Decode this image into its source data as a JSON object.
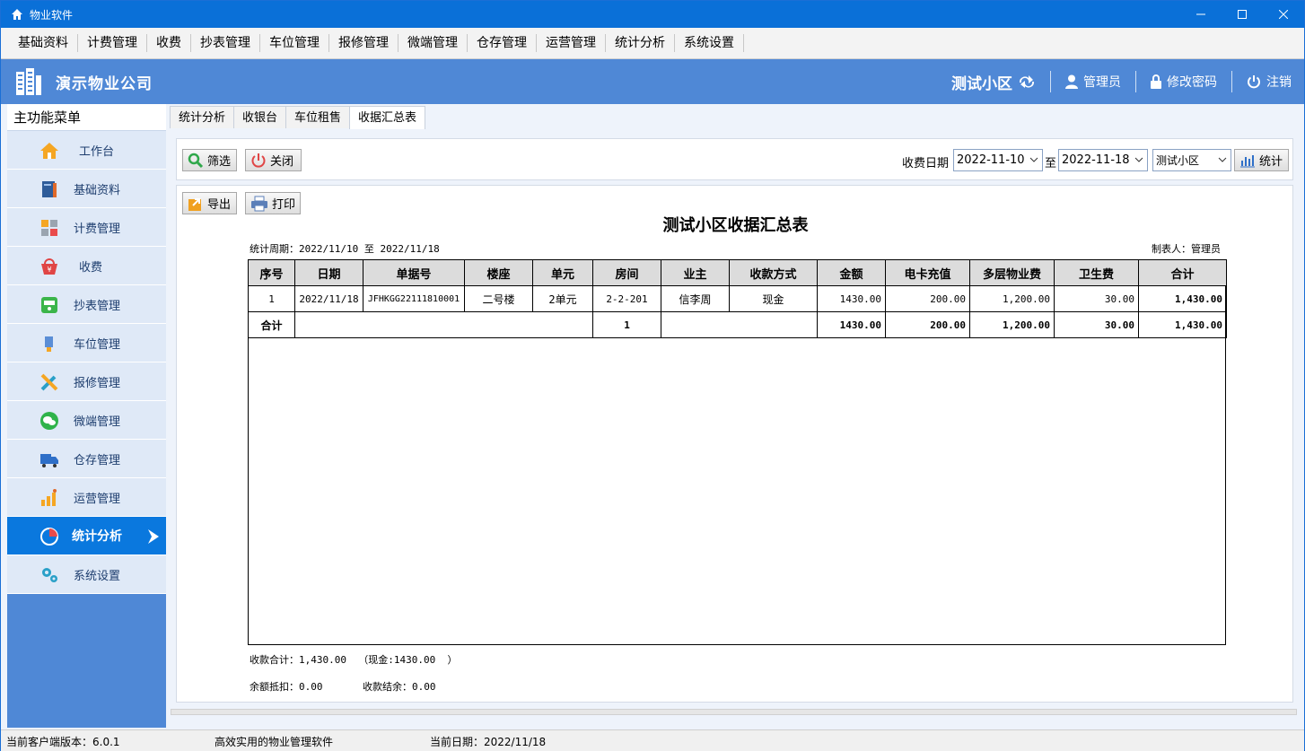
{
  "window": {
    "title": "物业软件"
  },
  "menu": [
    "基础资料",
    "计费管理",
    "收费",
    "抄表管理",
    "车位管理",
    "报修管理",
    "微端管理",
    "仓存管理",
    "运营管理",
    "统计分析",
    "系统设置"
  ],
  "header": {
    "company": "演示物业公司",
    "community": "测试小区",
    "user": "管理员",
    "change_password": "修改密码",
    "logout": "注销"
  },
  "sidebar": {
    "title": "主功能菜单",
    "items": [
      {
        "label": "工作台",
        "icon": "home-icon"
      },
      {
        "label": "基础资料",
        "icon": "book-icon"
      },
      {
        "label": "计费管理",
        "icon": "calculator-icon"
      },
      {
        "label": "收费",
        "icon": "basket-icon"
      },
      {
        "label": "抄表管理",
        "icon": "meter-icon"
      },
      {
        "label": "车位管理",
        "icon": "parking-icon"
      },
      {
        "label": "报修管理",
        "icon": "tools-icon"
      },
      {
        "label": "微端管理",
        "icon": "wechat-icon"
      },
      {
        "label": "仓存管理",
        "icon": "truck-icon"
      },
      {
        "label": "运营管理",
        "icon": "growth-icon"
      },
      {
        "label": "统计分析",
        "icon": "pie-chart-icon"
      },
      {
        "label": "系统设置",
        "icon": "gears-icon"
      }
    ]
  },
  "tabs": [
    "统计分析",
    "收银台",
    "车位租售",
    "收据汇总表"
  ],
  "toolbar": {
    "filter": "筛选",
    "close": "关闭",
    "date_label": "收费日期",
    "date_from": "2022-11-10",
    "to": "至",
    "date_to": "2022-11-18",
    "community": "测试小区",
    "stats": "统计"
  },
  "report": {
    "export": "导出",
    "print": "打印",
    "title": "测试小区收据汇总表",
    "period": "统计周期：2022/11/10 至 2022/11/18",
    "maker": "制表人：管理员",
    "columns": [
      "序号",
      "日期",
      "单据号",
      "楼座",
      "单元",
      "房间",
      "业主",
      "收款方式",
      "金额",
      "电卡充值",
      "多层物业费",
      "卫生费",
      "合计"
    ],
    "row": {
      "seq": "1",
      "date": "2022/11/18",
      "doc": "JFHKGG22111810001",
      "building": "二号楼",
      "unit": "2单元",
      "room": "2-2-201",
      "owner": "信李周",
      "method": "现金",
      "amount": "1430.00",
      "card": "200.00",
      "fee": "1,200.00",
      "sanitation": "30.00",
      "total": "1,430.00"
    },
    "sum": {
      "label": "合计",
      "count": "1",
      "amount": "1430.00",
      "card": "200.00",
      "fee": "1,200.00",
      "sanitation": "30.00",
      "total": "1,430.00"
    },
    "footer1": "收款合计：1,430.00  （现金:1430.00  ）",
    "footer2a": "余额抵扣：0.00",
    "footer2b": "收款结余：0.00"
  },
  "status": {
    "version": "当前客户端版本：6.0.1",
    "slogan": "高效实用的物业管理软件",
    "date": "当前日期：2022/11/18"
  }
}
